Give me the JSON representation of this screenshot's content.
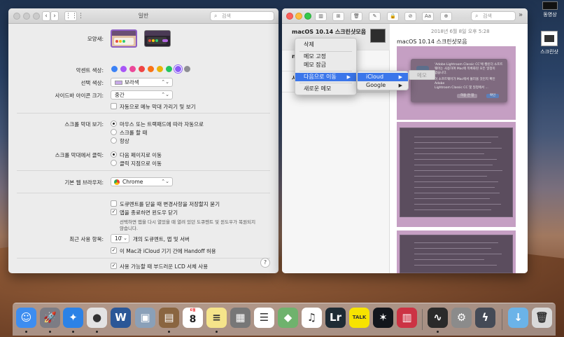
{
  "desktop": {
    "icons": [
      {
        "label": "동영상"
      },
      {
        "label": "스크린샷"
      }
    ]
  },
  "prefs": {
    "title": "일반",
    "search_placeholder": "검색",
    "appearance": {
      "label": "모양새:"
    },
    "accent": {
      "label": "악센트 색상:",
      "colors": [
        "#3b82f6",
        "#a855f7",
        "#ec4899",
        "#ef4444",
        "#f97316",
        "#eab308",
        "#22c55e",
        "#8b5cf6",
        "#8e8e93"
      ],
      "selected_index": 7
    },
    "highlight": {
      "label": "선택 색상:",
      "value": "보라색"
    },
    "sidebar_icon": {
      "label": "사이드바 아이콘 크기:",
      "value": "중간"
    },
    "menubar_auto": {
      "label": "자동으로 메뉴 막대 가리기 및 보기",
      "checked": false
    },
    "show_scrollbars": {
      "label": "스크롤 막대 보기:",
      "options": [
        "마우스 또는 트랙패드에 따라 자동으로",
        "스크롤 할 때",
        "항상"
      ],
      "selected_index": 0
    },
    "click_scrollbar": {
      "label": "스크롤 막대에서 클릭:",
      "options": [
        "다음 페이지로 이동",
        "클릭 지점으로 이동"
      ],
      "selected_index": 0
    },
    "browser": {
      "label": "기본 웹 브라우저:",
      "value": "Chrome"
    },
    "ask_keep_changes": {
      "label": "도큐멘트를 닫을 때 변경사항을 저장할지 묻기",
      "checked": false
    },
    "close_windows": {
      "label": "앱을 종료하면 윈도우 닫기",
      "checked": true
    },
    "close_windows_note": [
      "선택하면 앱을 다시 열었을 때 열려 있던 도큐멘트 및 윈도우가 복원되지",
      "않습니다."
    ],
    "recent_items": {
      "label": "최근 사용 항목:",
      "value": "10",
      "suffix": "개의 도큐멘트, 앱 및 서버"
    },
    "handoff": {
      "label": "이 Mac과 iCloud 기기 간에 Handoff 허용",
      "checked": true
    },
    "lcd_smoothing": {
      "label": "사용 가능할 때 부드러운 LCD 서체 사용",
      "checked": true
    },
    "help": "?"
  },
  "notes": {
    "search_placeholder": "검색",
    "more": "»",
    "note_title": "macOS 10.14 스크린샷모음",
    "note_date_partial": "오후 5:28",
    "editor_date": "2018년 6월 8일 오후 5:28",
    "editor_title": "macOS 10.14 스크린샷모음",
    "dialog": {
      "line1": "'Adobe Lightroom Classic CC'에 캘린더 소프트",
      "line2": "웨어는 사용하여 Mac에 목록화된 모든 일정이",
      "line3": "없습니다.",
      "line4": "이 소프트웨어가 Mac에서 불러올 것인지 확인 Adobe",
      "line5": "Lightroom Classic CC 몇 일정에서 ...",
      "btn_cancel": "허용 안 함",
      "btn_ok": "확인"
    },
    "hover_ghost": "메모",
    "list_partials": [
      "n",
      "시"
    ],
    "context_menu": {
      "items": [
        "삭제",
        "메모 고정",
        "메모 잠금",
        "다음으로 이동",
        "새로운 메모"
      ],
      "highlighted_index": 3,
      "submenu": [
        "iCloud",
        "Google"
      ],
      "submenu_highlighted_index": 0
    },
    "toolbar_aa": "Aa"
  },
  "dock": {
    "apps": [
      {
        "name": "Finder",
        "glyph": "☺",
        "color": "#3d8df0"
      },
      {
        "name": "Launchpad",
        "glyph": "🚀",
        "color": "#7c7c84"
      },
      {
        "name": "Safari",
        "glyph": "✦",
        "color": "#2c82e6"
      },
      {
        "name": "Chrome",
        "glyph": "●",
        "color": "#e3e3e3"
      },
      {
        "name": "Word",
        "glyph": "W",
        "color": "#2b5797"
      },
      {
        "name": "Preview",
        "glyph": "▣",
        "color": "#8aa0b8"
      },
      {
        "name": "Notefile",
        "glyph": "▤",
        "color": "#8a6540"
      },
      {
        "name": "Calendar",
        "glyph": "8",
        "color": "#ffffff"
      },
      {
        "name": "Notes",
        "glyph": "≡",
        "color": "#f5e48a"
      },
      {
        "name": "Calculator",
        "glyph": "▦",
        "color": "#777777"
      },
      {
        "name": "Reminders",
        "glyph": "☰",
        "color": "#ffffff"
      },
      {
        "name": "Maps",
        "glyph": "◆",
        "color": "#6fb26d"
      },
      {
        "name": "iTunes",
        "glyph": "♫",
        "color": "#ffffff"
      },
      {
        "name": "Lightroom",
        "glyph": "Lr",
        "color": "#1e2b34"
      },
      {
        "name": "KakaoTalk",
        "glyph": "TALK",
        "color": "#f7e300"
      },
      {
        "name": "Xcode",
        "glyph": "✶",
        "color": "#13161c"
      },
      {
        "name": "Screen",
        "glyph": "▥",
        "color": "#cc3344"
      },
      {
        "name": "Activity Monitor",
        "glyph": "∿",
        "color": "#2a2a2a"
      },
      {
        "name": "System Preferences",
        "glyph": "⚙",
        "color": "#8b8b8b"
      },
      {
        "name": "Rocket",
        "glyph": "ϟ",
        "color": "#444a56"
      },
      {
        "name": "Downloads Folder",
        "glyph": "↓",
        "color": "#6bb3e8"
      },
      {
        "name": "Trash",
        "glyph": "🗑",
        "color": "#d9d9d9"
      }
    ],
    "calendar_month": "6월"
  }
}
